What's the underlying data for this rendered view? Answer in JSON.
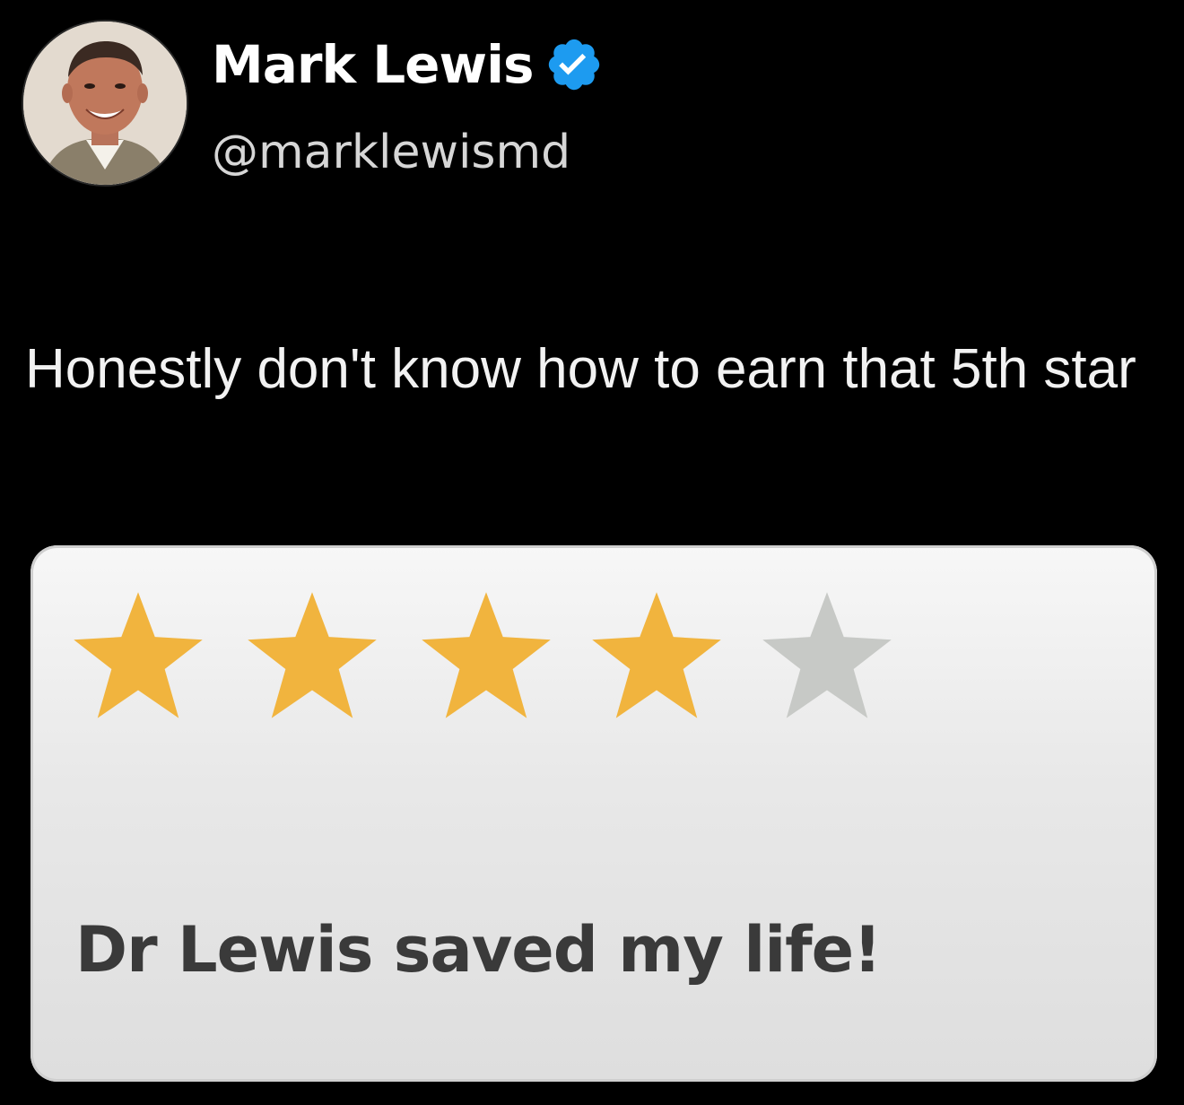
{
  "user": {
    "display_name": "Mark Lewis",
    "handle": "@marklewismd",
    "verified": true,
    "avatar_icon": "profile-photo",
    "verified_icon": "verified-badge-icon",
    "verified_color": "#1d9bf0"
  },
  "post": {
    "text": "Honestly don't know how to earn that 5th star"
  },
  "review": {
    "rating": 4,
    "max_rating": 5,
    "filled_star_color": "#f1b43e",
    "empty_star_color": "#c7c9c6",
    "text": "Dr Lewis saved my life!"
  },
  "colors": {
    "background": "#000000",
    "text": "#f2f2f2",
    "card_background": "#e8e8e8"
  }
}
